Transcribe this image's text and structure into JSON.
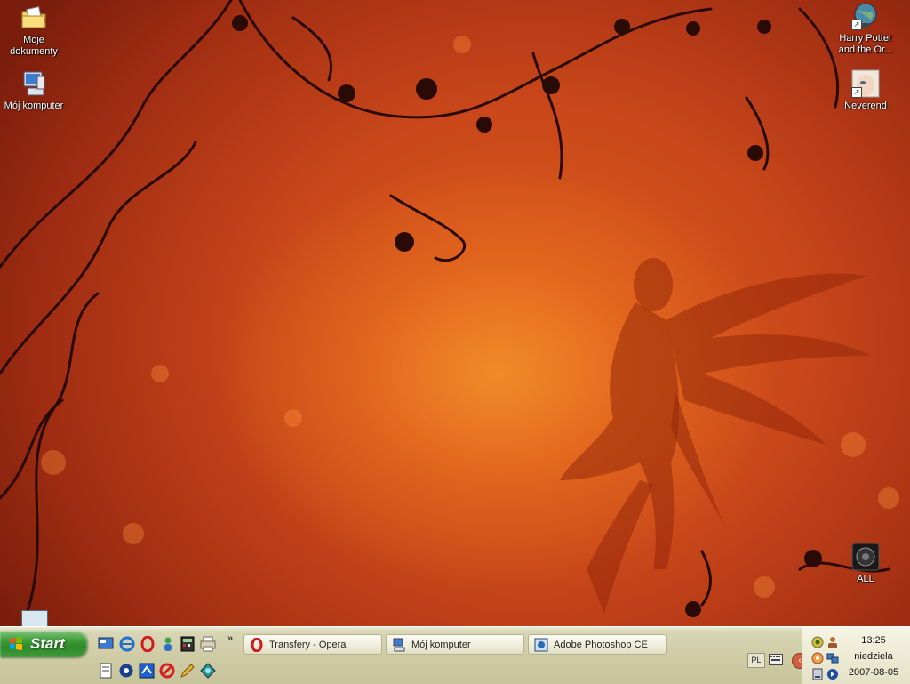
{
  "desktop": {
    "icons": [
      {
        "name": "Moje\ndokumenty",
        "icon": "folder-documents-icon"
      },
      {
        "name": "Mój komputer",
        "icon": "computer-icon"
      },
      {
        "name": "Harry Potter and the Or...",
        "icon": "globe-shortcut-icon"
      },
      {
        "name": "Neverend",
        "icon": "image-shortcut-icon"
      },
      {
        "name": "ALL",
        "icon": "speaker-icon"
      }
    ]
  },
  "taskbar": {
    "start_label": "Start",
    "chevron": "»",
    "tasks": [
      {
        "label": "Transfery - Opera",
        "icon": "opera-icon"
      },
      {
        "label": "Mój komputer",
        "icon": "computer-icon"
      },
      {
        "label": "Adobe Photoshop CE",
        "icon": "photoshop-icon"
      }
    ],
    "language": "PL"
  },
  "clock": {
    "time": "13:25",
    "day": "niedziela",
    "date": "2007-08-05"
  },
  "colors": {
    "wallpaper": "#c8461a",
    "start_green": "#3c9a36",
    "taskbar": "#cfcca6"
  }
}
